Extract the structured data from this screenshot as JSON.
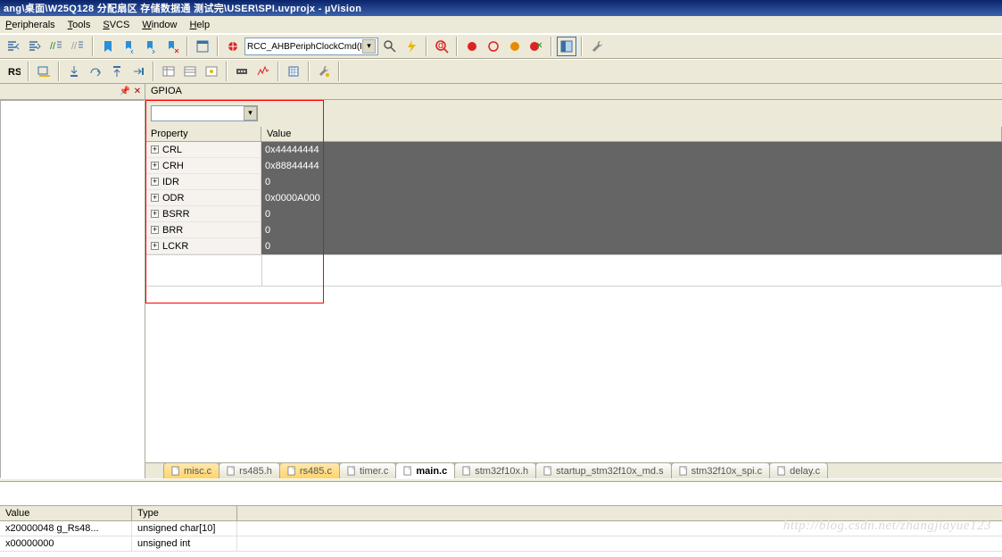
{
  "title_bar": "ang\\桌面\\W25Q128 分配扇区 存储数据通 测试完\\USER\\SPI.uvprojx - µVision",
  "menu": {
    "peripherals": "Peripherals",
    "tools": "Tools",
    "svcs": "SVCS",
    "window": "Window",
    "help": "Help"
  },
  "toolbar_combo": {
    "text": "RCC_AHBPeriphClockCmd(I"
  },
  "panel_title": "GPIOA",
  "prop_header": {
    "col1": "Property",
    "col2": "Value"
  },
  "prop_rows": [
    {
      "name": "CRL",
      "value": "0x44444444"
    },
    {
      "name": "CRH",
      "value": "0x88844444"
    },
    {
      "name": "IDR",
      "value": "0"
    },
    {
      "name": "ODR",
      "value": "0x0000A000"
    },
    {
      "name": "BSRR",
      "value": "0"
    },
    {
      "name": "BRR",
      "value": "0"
    },
    {
      "name": "LCKR",
      "value": "0"
    }
  ],
  "tabs": [
    {
      "label": "misc.c",
      "style": "orange"
    },
    {
      "label": "rs485.h",
      "style": ""
    },
    {
      "label": "rs485.c",
      "style": "orange"
    },
    {
      "label": "timer.c",
      "style": ""
    },
    {
      "label": "main.c",
      "style": "active"
    },
    {
      "label": "stm32f10x.h",
      "style": ""
    },
    {
      "label": "startup_stm32f10x_md.s",
      "style": ""
    },
    {
      "label": "stm32f10x_spi.c",
      "style": ""
    },
    {
      "label": "delay.c",
      "style": ""
    }
  ],
  "watch": {
    "header": {
      "c1": "Value",
      "c2": "Type"
    },
    "rows": [
      {
        "value": "x20000048 g_Rs48...",
        "type": "unsigned char[10]"
      },
      {
        "value": "x00000000",
        "type": "unsigned int"
      }
    ]
  },
  "watermark": "http://blog.csdn.net/zhangjiayue123",
  "icons": {
    "pin": "📌",
    "close": "✕",
    "dropdown": "▾",
    "expand": "+",
    "file": "📄",
    "gear": "⚙",
    "find": "🔍"
  },
  "colors": {
    "tb_red": "#d22",
    "tb_blue": "#1060c0",
    "tb_green": "#2a8f2a",
    "tb_orange": "#e68a00",
    "tb_gray": "#888"
  }
}
